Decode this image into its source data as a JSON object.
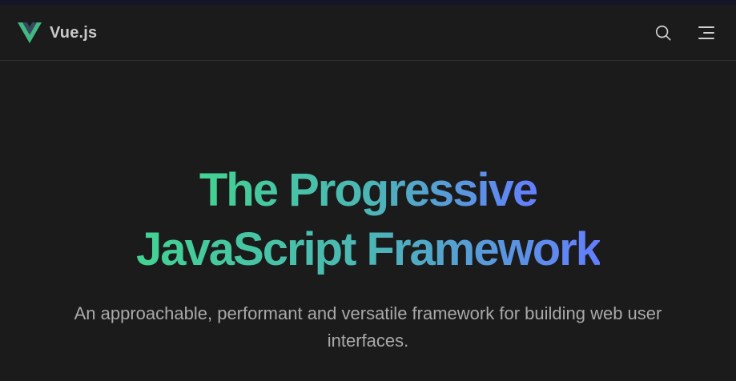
{
  "nav": {
    "brand": "Vue.js",
    "icons": {
      "logo": "vue-logo",
      "search": "search-icon",
      "menu": "menu-icon"
    }
  },
  "hero": {
    "title_line1": "The Progressive",
    "title_line2": "JavaScript Framework",
    "tagline": "An approachable, performant and versatile framework for building web user interfaces."
  },
  "colors": {
    "background": "#1b1b1b",
    "topstrip": "#121628",
    "gradient_start": "#42d392",
    "gradient_end": "#647eff",
    "brand_text": "#c9c9c9",
    "tagline_text": "#a9a9a9",
    "logo_outer": "#42b883",
    "logo_inner": "#35495e"
  }
}
